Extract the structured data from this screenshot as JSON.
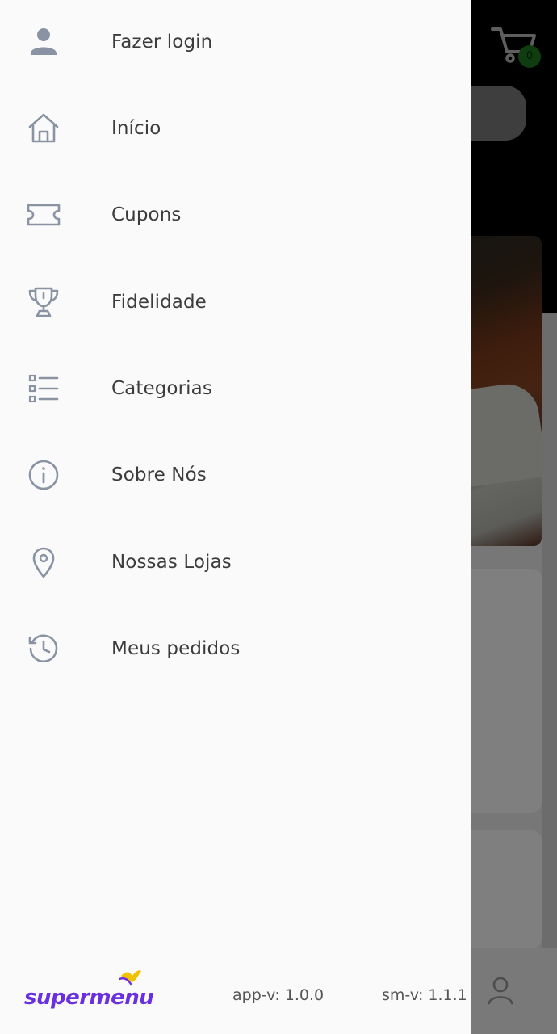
{
  "drawer": {
    "items": [
      {
        "label": "Fazer login",
        "icon": "user-icon"
      },
      {
        "label": "Início",
        "icon": "home-icon"
      },
      {
        "label": "Cupons",
        "icon": "ticket-icon"
      },
      {
        "label": "Fidelidade",
        "icon": "trophy-icon"
      },
      {
        "label": "Categorias",
        "icon": "list-icon"
      },
      {
        "label": "Sobre Nós",
        "icon": "info-icon"
      },
      {
        "label": "Nossas Lojas",
        "icon": "location-pin-icon"
      },
      {
        "label": "Meus pedidos",
        "icon": "history-icon"
      }
    ],
    "footer": {
      "brand": "supermenu",
      "app_version": "app-v: 1.0.0",
      "sm_version": "sm-v: 1.1.1"
    }
  },
  "background": {
    "cart_count": "0"
  },
  "colors": {
    "icon": "#8a93a3",
    "label": "#3c3c3c",
    "brand": "#6a2fe0",
    "brand_accent": "#f2c200",
    "cart_badge": "#1f7a1f"
  }
}
